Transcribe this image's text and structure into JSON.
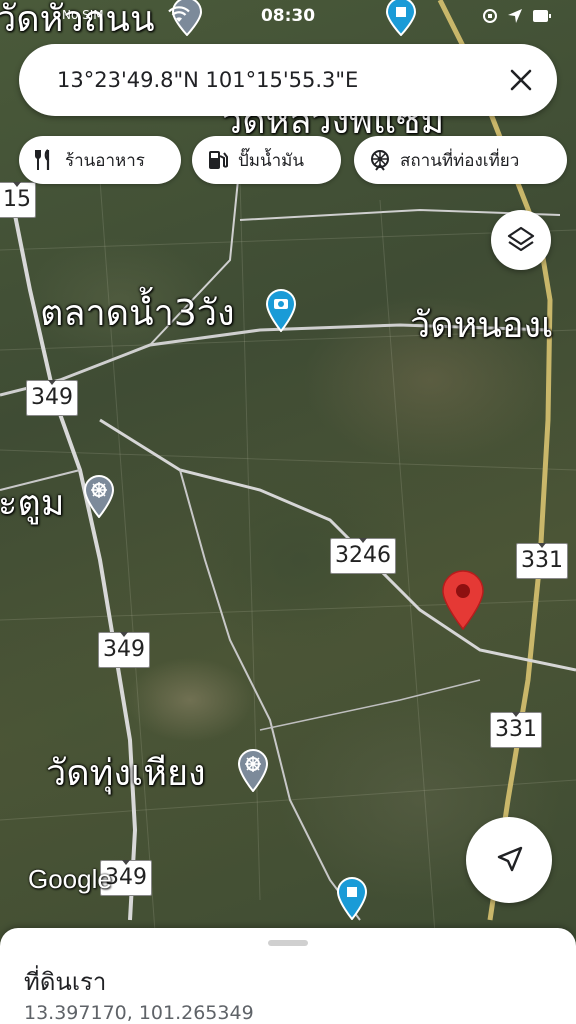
{
  "status_bar": {
    "time": "08:30",
    "carrier": "No SIM"
  },
  "search": {
    "query": "13°23'49.8\"N 101°15'55.3\"E"
  },
  "chips": [
    {
      "label": "ร้านอาหาร",
      "icon": "restaurant-icon"
    },
    {
      "label": "ปั๊มน้ำมัน",
      "icon": "gas-station-icon"
    },
    {
      "label": "สถานที่ท่องเที่ยว",
      "icon": "attraction-icon"
    }
  ],
  "map_labels": {
    "top_left": "วัดหัวถนน",
    "top_center": "วัดหลวงพแซม",
    "market": "ตลาดน้ำ3วัง",
    "right": "วัดหนองเ",
    "left_mid": "ะตูม",
    "temple": "วัดทุ่งเหียง"
  },
  "route_shields": {
    "r15": "15",
    "r349_a": "349",
    "r349_b": "349",
    "r349_c": "349",
    "r3246": "3246",
    "r331_a": "331",
    "r331_b": "331"
  },
  "google_logo": "Google",
  "place": {
    "title": "ที่ดินเรา",
    "coordinates": "13.397170, 101.265349"
  },
  "colors": {
    "pin": "#e53935",
    "poi_blue": "#1a9bd7",
    "poi_gray": "#7c8a9a"
  }
}
